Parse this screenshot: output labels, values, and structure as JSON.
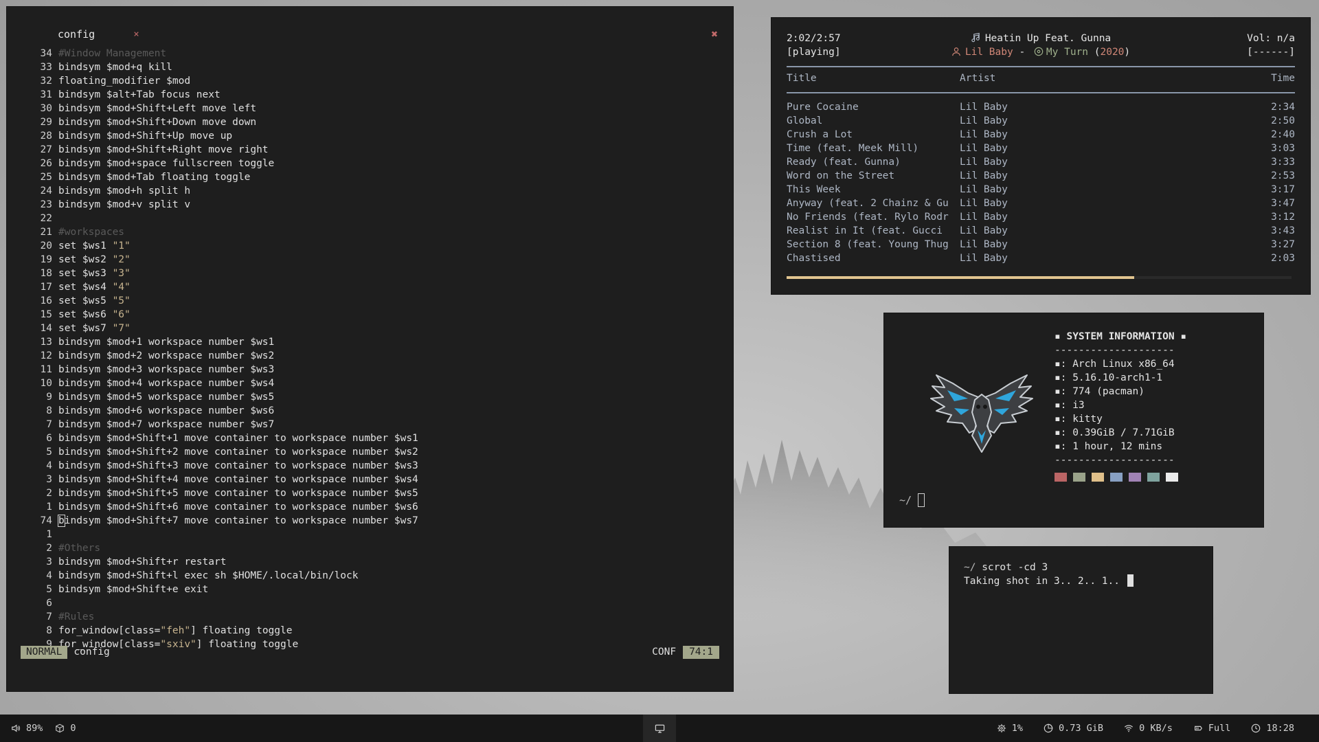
{
  "editor": {
    "tab_name": "config",
    "tab_close": "×",
    "window_close": "✖",
    "lines": [
      {
        "n": "34",
        "text": "#Window Management",
        "type": "comment"
      },
      {
        "n": "33",
        "text": "bindsym $mod+q kill"
      },
      {
        "n": "32",
        "text": "floating_modifier $mod"
      },
      {
        "n": "31",
        "text": "bindsym $alt+Tab focus next"
      },
      {
        "n": "30",
        "text": "bindsym $mod+Shift+Left move left"
      },
      {
        "n": "29",
        "text": "bindsym $mod+Shift+Down move down"
      },
      {
        "n": "28",
        "text": "bindsym $mod+Shift+Up move up"
      },
      {
        "n": "27",
        "text": "bindsym $mod+Shift+Right move right"
      },
      {
        "n": "26",
        "text": "bindsym $mod+space fullscreen toggle"
      },
      {
        "n": "25",
        "text": "bindsym $mod+Tab floating toggle"
      },
      {
        "n": "24",
        "text": "bindsym $mod+h split h"
      },
      {
        "n": "23",
        "text": "bindsym $mod+v split v"
      },
      {
        "n": "22",
        "text": ""
      },
      {
        "n": "21",
        "text": "#workspaces",
        "type": "comment"
      },
      {
        "n": "20",
        "text": "set $ws1 ",
        "str": "\"1\""
      },
      {
        "n": "19",
        "text": "set $ws2 ",
        "str": "\"2\""
      },
      {
        "n": "18",
        "text": "set $ws3 ",
        "str": "\"3\""
      },
      {
        "n": "17",
        "text": "set $ws4 ",
        "str": "\"4\""
      },
      {
        "n": "16",
        "text": "set $ws5 ",
        "str": "\"5\""
      },
      {
        "n": "15",
        "text": "set $ws6 ",
        "str": "\"6\""
      },
      {
        "n": "14",
        "text": "set $ws7 ",
        "str": "\"7\""
      },
      {
        "n": "13",
        "text": "bindsym $mod+1 workspace number $ws1"
      },
      {
        "n": "12",
        "text": "bindsym $mod+2 workspace number $ws2"
      },
      {
        "n": "11",
        "text": "bindsym $mod+3 workspace number $ws3"
      },
      {
        "n": "10",
        "text": "bindsym $mod+4 workspace number $ws4"
      },
      {
        "n": "9",
        "text": "bindsym $mod+5 workspace number $ws5"
      },
      {
        "n": "8",
        "text": "bindsym $mod+6 workspace number $ws6"
      },
      {
        "n": "7",
        "text": "bindsym $mod+7 workspace number $ws7"
      },
      {
        "n": "6",
        "text": "bindsym $mod+Shift+1 move container to workspace number $ws1"
      },
      {
        "n": "5",
        "text": "bindsym $mod+Shift+2 move container to workspace number $ws2"
      },
      {
        "n": "4",
        "text": "bindsym $mod+Shift+3 move container to workspace number $ws3"
      },
      {
        "n": "3",
        "text": "bindsym $mod+Shift+4 move container to workspace number $ws4"
      },
      {
        "n": "2",
        "text": "bindsym $mod+Shift+5 move container to workspace number $ws5"
      },
      {
        "n": "1",
        "text": "bindsym $mod+Shift+6 move container to workspace number $ws6"
      },
      {
        "n": "74",
        "text": "bindsym $mod+Shift+7 move container to workspace number $ws7",
        "cursor": true
      },
      {
        "n": "1",
        "text": ""
      },
      {
        "n": "2",
        "text": "#Others",
        "type": "comment"
      },
      {
        "n": "3",
        "text": "bindsym $mod+Shift+r restart"
      },
      {
        "n": "4",
        "text": "bindsym $mod+Shift+l exec sh $HOME/.local/bin/lock"
      },
      {
        "n": "5",
        "text": "bindsym $mod+Shift+e exit"
      },
      {
        "n": "6",
        "text": ""
      },
      {
        "n": "7",
        "text": "#Rules",
        "type": "comment"
      },
      {
        "n": "8",
        "text": "for_window[class=",
        "str": "\"feh\"",
        "after": "] floating toggle"
      },
      {
        "n": "9",
        "text": "for_window[class=",
        "str": "\"sxiv\"",
        "after": "] floating toggle"
      }
    ],
    "status": {
      "mode": "NORMAL",
      "file": "config",
      "filetype": "CONF",
      "position": "74:1"
    },
    "colors": {
      "mode_bg": "#a3a78b",
      "comment": "#5a5a5a",
      "string": "#c7b48f"
    }
  },
  "music": {
    "elapsed": "2:02/2:57",
    "state": "[playing]",
    "title": "Heatin Up Feat. Gunna",
    "artist": "Lil Baby",
    "dash": "-",
    "album": "My Turn",
    "year_open": "(",
    "year": "2020",
    "year_close": ")",
    "volume": "Vol: n/a",
    "volume_bar": "[------]",
    "headers": {
      "title": "Title",
      "artist": "Artist",
      "time": "Time"
    },
    "tracks": [
      {
        "title": "Pure Cocaine",
        "artist": "Lil Baby",
        "time": "2:34"
      },
      {
        "title": "Global",
        "artist": "Lil Baby",
        "time": "2:50"
      },
      {
        "title": "Crush a Lot",
        "artist": "Lil Baby",
        "time": "2:40"
      },
      {
        "title": "Time (feat. Meek Mill)",
        "artist": "Lil Baby",
        "time": "3:03"
      },
      {
        "title": "Ready (feat. Gunna)",
        "artist": "Lil Baby",
        "time": "3:33"
      },
      {
        "title": "Word on the Street",
        "artist": "Lil Baby",
        "time": "2:53"
      },
      {
        "title": "This Week",
        "artist": "Lil Baby",
        "time": "3:17"
      },
      {
        "title": "Anyway (feat. 2 Chainz & Gu",
        "artist": "Lil Baby",
        "time": "3:47"
      },
      {
        "title": "No Friends (feat. Rylo Rodr",
        "artist": "Lil Baby",
        "time": "3:12"
      },
      {
        "title": "Realist in It (feat. Gucci",
        "artist": "Lil Baby",
        "time": "3:43"
      },
      {
        "title": "Section 8 (feat. Young Thug",
        "artist": "Lil Baby",
        "time": "3:27"
      },
      {
        "title": "Chastised",
        "artist": "Lil Baby",
        "time": "2:03"
      }
    ],
    "progress_fraction": 0.689,
    "colors": {
      "progress": "#e1c48f",
      "artist": "#d18777",
      "album": "#9fb08c"
    }
  },
  "sysinfo": {
    "header_left": "▪",
    "header": "SYSTEM INFORMATION",
    "header_right": "▪",
    "rule": "--------------------",
    "rows": [
      {
        "mark": "▪",
        "text": ": Arch Linux x86_64"
      },
      {
        "mark": "▪",
        "text": ": 5.16.10-arch1-1"
      },
      {
        "mark": "▪",
        "text": ": 774 (pacman)"
      },
      {
        "mark": "▪",
        "text": ": i3"
      },
      {
        "mark": "▪",
        "text": ": kitty"
      },
      {
        "mark": "▪",
        "text": ": 0.39GiB / 7.71GiB"
      },
      {
        "mark": "▪",
        "text": ": 1 hour, 12 mins"
      }
    ],
    "swatches": [
      "#bb6565",
      "#9aa38a",
      "#e0c08a",
      "#88a0c2",
      "#a183b5",
      "#7fa39e",
      "#ebebeb"
    ],
    "prompt": "~/",
    "logo_icon": "eagle-logo"
  },
  "scrot": {
    "prompt": "~/",
    "command": "scrot -cd 3",
    "output": "Taking shot in 3.. 2.. 1.."
  },
  "bar": {
    "volume": "89%",
    "packages": "0",
    "cpu": "1%",
    "memory": "0.73 GiB",
    "network": "0 KB/s",
    "battery": "Full",
    "clock": "18:28",
    "icons": [
      "volume-icon",
      "package-icon",
      "monitor-icon",
      "cpu-icon",
      "memory-icon",
      "wifi-icon",
      "battery-icon",
      "clock-icon"
    ]
  }
}
